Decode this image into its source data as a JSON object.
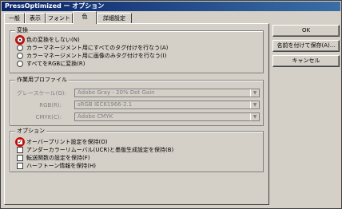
{
  "window": {
    "title": "PressOptimized ー オプション"
  },
  "tabs": [
    {
      "label": "一般"
    },
    {
      "label": "表示"
    },
    {
      "label": "フォント"
    },
    {
      "label": "色"
    },
    {
      "label": "詳細設定"
    }
  ],
  "conversion": {
    "label": "変換",
    "options": [
      {
        "label": "色の変換をしない(N)",
        "selected": true
      },
      {
        "label": "カラーマネージメント用にすべてのタグ付けを行なう(A)",
        "selected": false
      },
      {
        "label": "カラーマネージメント用に画像のみタグ付けを行なう(I)",
        "selected": false
      },
      {
        "label": "すべてをRGBに変換(R)",
        "selected": false
      }
    ]
  },
  "profiles": {
    "label": "作業用プロファイル",
    "rows": [
      {
        "label": "グレースケール(G):",
        "value": "Adobe Gray - 20% Dot Gain"
      },
      {
        "label": "RGB(R):",
        "value": "sRGB IEC61966-2.1"
      },
      {
        "label": "CMYK(C):",
        "value": "Adobe CMYK"
      }
    ]
  },
  "options": {
    "label": "オプション",
    "items": [
      {
        "label": "オーバープリント設定を保持(O)",
        "checked": true
      },
      {
        "label": "アンダーカラーリムーバル(UCR)と墨版生成設定を保持(B)",
        "checked": false
      },
      {
        "label": "転送関数の設定を保持(F)",
        "checked": false
      },
      {
        "label": "ハーフトーン情報を保持(H)",
        "checked": false
      }
    ]
  },
  "buttons": {
    "ok": "OK",
    "save_as": "名前を付けて保存(A)...",
    "cancel": "キャンセル"
  },
  "highlight_color": "#e00000"
}
